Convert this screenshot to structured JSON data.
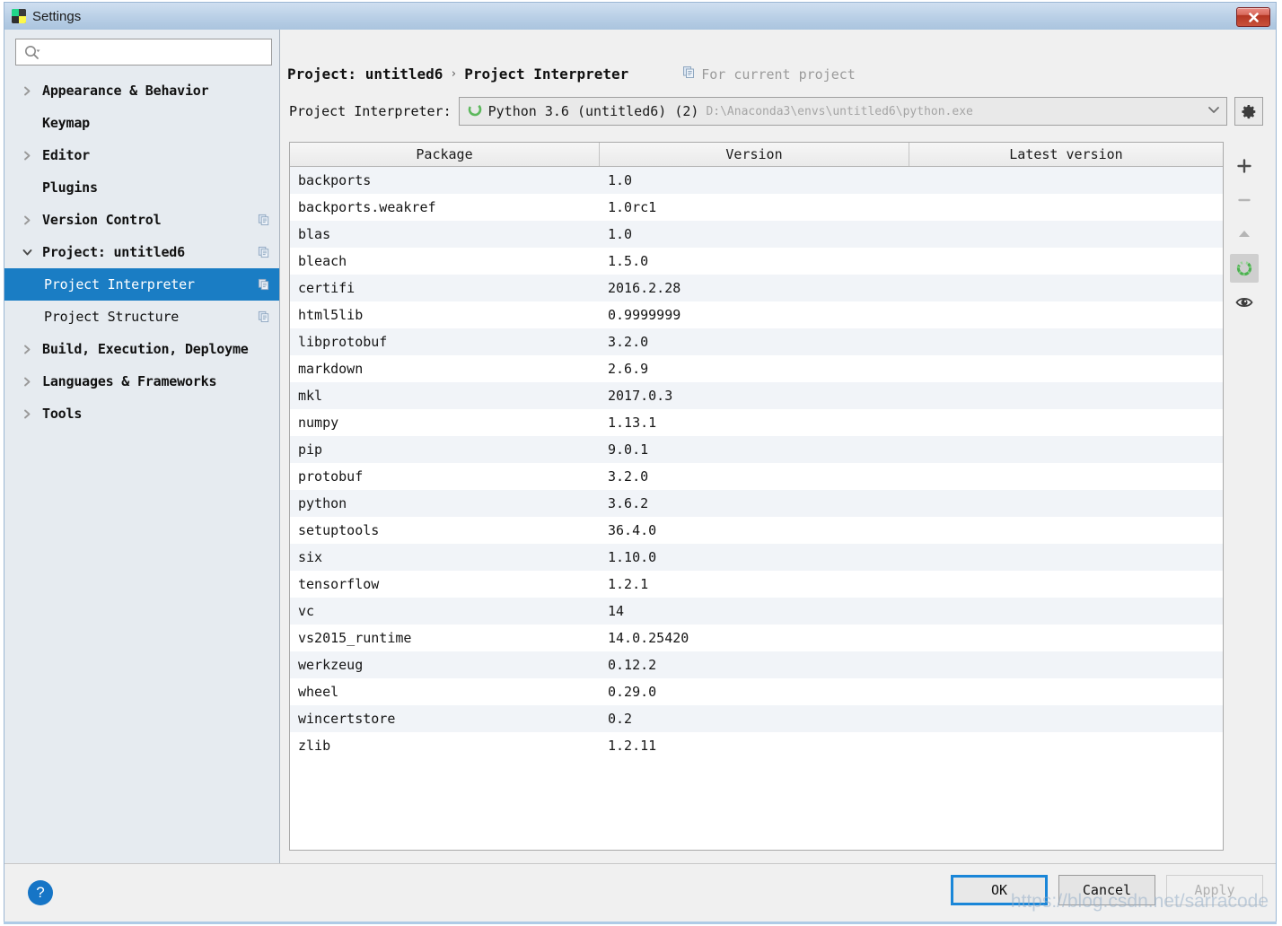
{
  "window": {
    "title": "Settings",
    "app_icon": "pycharm-icon",
    "close_icon": "close-icon"
  },
  "sidebar": {
    "search": {
      "placeholder": "",
      "value": "",
      "icon": "search-icon"
    },
    "items": [
      {
        "label": "Appearance & Behavior",
        "twisty": "right",
        "bold": true,
        "child": false,
        "badge": false,
        "selected": false
      },
      {
        "label": "Keymap",
        "twisty": "none",
        "bold": true,
        "child": false,
        "badge": false,
        "selected": false
      },
      {
        "label": "Editor",
        "twisty": "right",
        "bold": true,
        "child": false,
        "badge": false,
        "selected": false
      },
      {
        "label": "Plugins",
        "twisty": "none",
        "bold": true,
        "child": false,
        "badge": false,
        "selected": false
      },
      {
        "label": "Version Control",
        "twisty": "right",
        "bold": true,
        "child": false,
        "badge": true,
        "selected": false
      },
      {
        "label": "Project: untitled6",
        "twisty": "down",
        "bold": true,
        "child": false,
        "badge": true,
        "selected": false
      },
      {
        "label": "Project Interpreter",
        "twisty": "none",
        "bold": false,
        "child": true,
        "badge": true,
        "selected": true
      },
      {
        "label": "Project Structure",
        "twisty": "none",
        "bold": false,
        "child": true,
        "badge": true,
        "selected": false
      },
      {
        "label": "Build, Execution, Deployme",
        "twisty": "right",
        "bold": true,
        "child": false,
        "badge": false,
        "selected": false
      },
      {
        "label": "Languages & Frameworks",
        "twisty": "right",
        "bold": true,
        "child": false,
        "badge": false,
        "selected": false
      },
      {
        "label": "Tools",
        "twisty": "right",
        "bold": true,
        "child": false,
        "badge": false,
        "selected": false
      }
    ]
  },
  "header": {
    "crumb_project": "Project: untitled6",
    "crumb_sep": "›",
    "crumb_page": "Project Interpreter",
    "for_current_project": "For current project",
    "for_current_icon": "copy-scope-icon"
  },
  "interpreter": {
    "label": "Project Interpreter:",
    "icon": "python-env-icon",
    "name": "Python 3.6 (untitled6) (2)",
    "path": "D:\\Anaconda3\\envs\\untitled6\\python.exe",
    "dropdown_icon": "chevron-down-icon",
    "settings_icon": "gear-icon"
  },
  "packages_table": {
    "columns": [
      "Package",
      "Version",
      "Latest version"
    ],
    "rows": [
      {
        "package": "backports",
        "version": "1.0",
        "latest": "",
        "loading": true
      },
      {
        "package": "backports.weakref",
        "version": "1.0rc1",
        "latest": "",
        "loading": false
      },
      {
        "package": "blas",
        "version": "1.0",
        "latest": "",
        "loading": false
      },
      {
        "package": "bleach",
        "version": "1.5.0",
        "latest": "",
        "loading": false
      },
      {
        "package": "certifi",
        "version": "2016.2.28",
        "latest": "",
        "loading": false
      },
      {
        "package": "html5lib",
        "version": "0.9999999",
        "latest": "",
        "loading": false
      },
      {
        "package": "libprotobuf",
        "version": "3.2.0",
        "latest": "",
        "loading": false
      },
      {
        "package": "markdown",
        "version": "2.6.9",
        "latest": "",
        "loading": false
      },
      {
        "package": "mkl",
        "version": "2017.0.3",
        "latest": "",
        "loading": false
      },
      {
        "package": "numpy",
        "version": "1.13.1",
        "latest": "",
        "loading": false
      },
      {
        "package": "pip",
        "version": "9.0.1",
        "latest": "",
        "loading": false
      },
      {
        "package": "protobuf",
        "version": "3.2.0",
        "latest": "",
        "loading": false
      },
      {
        "package": "python",
        "version": "3.6.2",
        "latest": "",
        "loading": false
      },
      {
        "package": "setuptools",
        "version": "36.4.0",
        "latest": "",
        "loading": false
      },
      {
        "package": "six",
        "version": "1.10.0",
        "latest": "",
        "loading": false
      },
      {
        "package": "tensorflow",
        "version": "1.2.1",
        "latest": "",
        "loading": false
      },
      {
        "package": "vc",
        "version": "14",
        "latest": "",
        "loading": false
      },
      {
        "package": "vs2015_runtime",
        "version": "14.0.25420",
        "latest": "",
        "loading": false
      },
      {
        "package": "werkzeug",
        "version": "0.12.2",
        "latest": "",
        "loading": false
      },
      {
        "package": "wheel",
        "version": "0.29.0",
        "latest": "",
        "loading": false
      },
      {
        "package": "wincertstore",
        "version": "0.2",
        "latest": "",
        "loading": false
      },
      {
        "package": "zlib",
        "version": "1.2.11",
        "latest": "",
        "loading": false
      }
    ]
  },
  "table_toolbar": [
    {
      "name": "add-package-button",
      "icon": "plus-icon",
      "active": false,
      "enabled": true
    },
    {
      "name": "remove-package-button",
      "icon": "minus-icon",
      "active": false,
      "enabled": false
    },
    {
      "name": "upgrade-package-button",
      "icon": "triangle-up-icon",
      "active": false,
      "enabled": false
    },
    {
      "name": "refresh-button",
      "icon": "spinner-icon",
      "active": true,
      "enabled": true
    },
    {
      "name": "show-early-releases-button",
      "icon": "eye-icon",
      "active": false,
      "enabled": true
    }
  ],
  "footer": {
    "help_label": "?",
    "ok_label": "OK",
    "cancel_label": "Cancel",
    "apply_label": "Apply",
    "watermark": "https://blog.csdn.net/sarracode"
  },
  "colors": {
    "selection_blue": "#1a7dc4",
    "default_button_border": "#1a86d8",
    "titlebar_blue": "#b9cfe6",
    "close_red": "#b33522",
    "green_env": "#5cb85c",
    "row_alt": "#f1f4f8"
  }
}
